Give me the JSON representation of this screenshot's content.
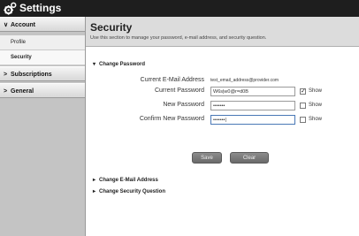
{
  "window": {
    "title": "Settings",
    "icon": "gear-icon"
  },
  "sidebar": {
    "sections": [
      {
        "label": "Account",
        "expanded": true,
        "chevron": "∨",
        "items": [
          {
            "label": "Profile"
          },
          {
            "label": "Security",
            "active": true
          }
        ]
      },
      {
        "label": "Subscriptions",
        "expanded": false,
        "chevron": ">"
      },
      {
        "label": "General",
        "expanded": false,
        "chevron": ">"
      }
    ]
  },
  "main": {
    "title": "Security",
    "description": "Use this section to manage your password, e-mail address, and security question.",
    "change_password": {
      "label": "Change Password",
      "expanded": true,
      "arrow": "▾",
      "email_label": "Current E-Mail Address",
      "email_value": "test_email_address@provider.com",
      "current_label": "Current Password",
      "current_value": "W6s|w0@r=d0B",
      "new_label": "New Password",
      "new_value": "•••••••",
      "confirm_label": "Confirm New Password",
      "confirm_value": "•••••••|",
      "show_label": "Show",
      "show_current_checked": true,
      "check_mark": "✓",
      "save_label": "Save",
      "clear_label": "Clear"
    },
    "change_email": {
      "label": "Change E-Mail Address",
      "arrow": "▸"
    },
    "change_question": {
      "label": "Change Security Question",
      "arrow": "▸"
    }
  },
  "colors": {
    "titlebar": "#1e1e1e",
    "sidebar": "#c4c4c4",
    "header": "#dcdcdc",
    "focus": "#4a78b6",
    "button": "#7a7a7a"
  }
}
